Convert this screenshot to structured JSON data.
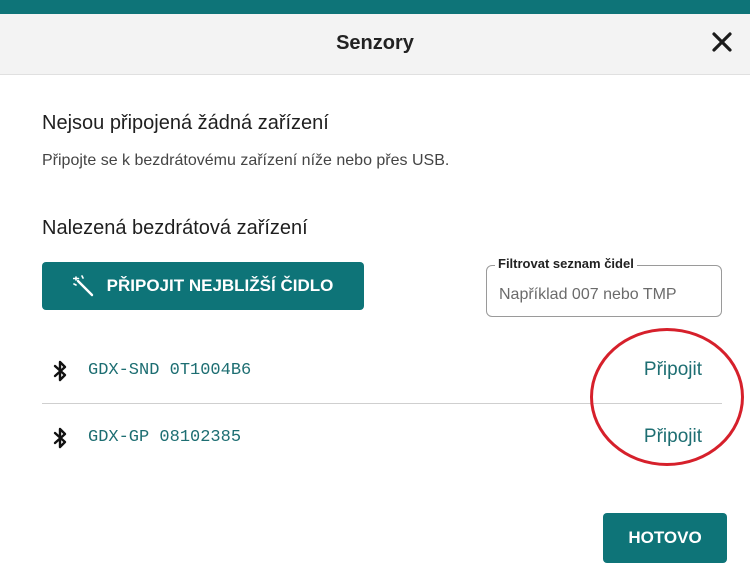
{
  "dialog": {
    "title": "Senzory",
    "close_icon": "close-icon"
  },
  "status": {
    "heading": "Nejsou připojená žádná zařízení",
    "subtext": "Připojte se k bezdrátovému zařízení níže nebo přes USB."
  },
  "wireless": {
    "heading": "Nalezená bezdrátová zařízení",
    "connect_nearest_label": "PŘIPOJIT NEJBLIŽŠÍ ČIDLO",
    "connect_nearest_icon": "wand-icon",
    "filter": {
      "legend": "Filtrovat seznam čidel",
      "placeholder": "Například 007 nebo TMP",
      "value": ""
    },
    "devices": [
      {
        "name": "GDX-SND 0T1004B6",
        "icon": "bluetooth-icon",
        "action_label": "Připojit"
      },
      {
        "name": "GDX-GP 08102385",
        "icon": "bluetooth-icon",
        "action_label": "Připojit"
      }
    ]
  },
  "footer": {
    "done_label": "HOTOVO"
  },
  "colors": {
    "accent": "#0e7478",
    "link": "#1d6e72",
    "annotation": "#d6202b"
  }
}
